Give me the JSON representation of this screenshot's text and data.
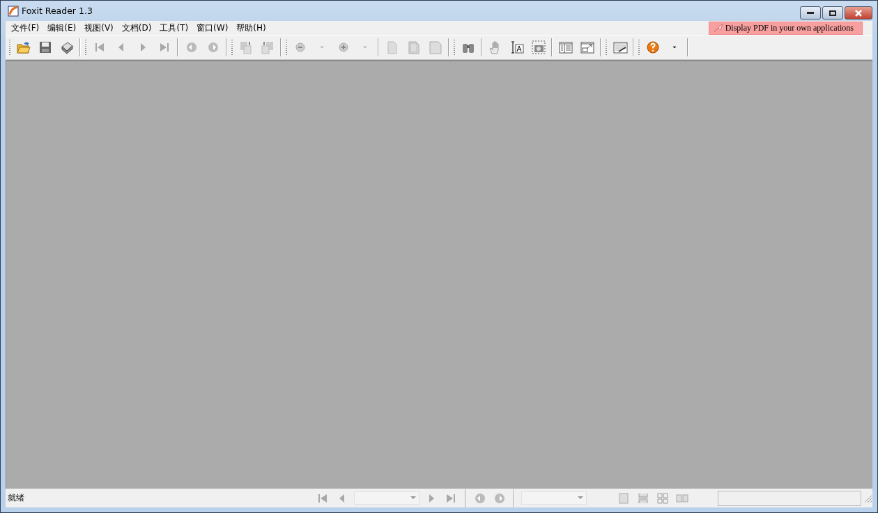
{
  "window": {
    "title": "Foxit Reader 1.3"
  },
  "menu": [
    {
      "label": "文件(F)"
    },
    {
      "label": "编辑(E)"
    },
    {
      "label": "视图(V)"
    },
    {
      "label": "文档(D)"
    },
    {
      "label": "工具(T)"
    },
    {
      "label": "窗口(W)"
    },
    {
      "label": "帮助(H)"
    }
  ],
  "ad_banner": {
    "label": "Display PDF in your own applications"
  },
  "status_bar": {
    "text": "就绪"
  }
}
